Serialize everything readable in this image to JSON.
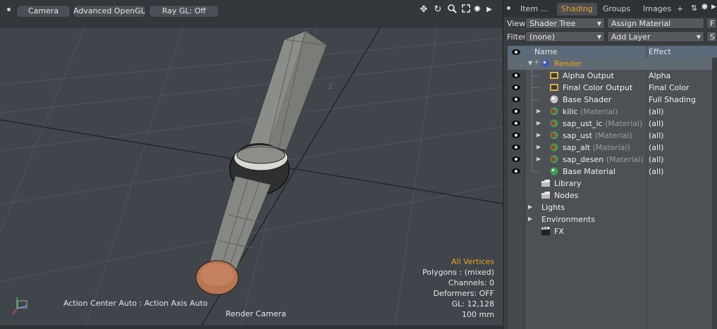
{
  "viewport": {
    "buttons": {
      "camera": "Camera",
      "opengl": "Advanced OpenGL",
      "raygl": "Ray GL: Off"
    },
    "icons": [
      "move-icon",
      "rotate-icon",
      "zoom-icon",
      "maximize-icon",
      "gear-icon",
      "play-arrow-icon"
    ],
    "axis_label": "Z",
    "hud": {
      "mode": "All Vertices",
      "polygons": "Polygons : (mixed)",
      "channels": "Channels: 0",
      "deformers": "Deformers: OFF",
      "gl": "GL: 12,128",
      "scale": "100 mm",
      "action_center": "Action Center Auto : Action Axis Auto",
      "camera_label": "Render Camera"
    },
    "colors": {
      "hud_highlight": "#f0a020",
      "background": "#3f454b"
    }
  },
  "panel": {
    "tabs": [
      {
        "label": "Item ..."
      },
      {
        "label": "Shading"
      },
      {
        "label": "Groups"
      },
      {
        "label": "Images"
      }
    ],
    "add_tab": "+",
    "view_label": "View",
    "view_value": "Shader Tree",
    "assign_material": "Assign Material",
    "f_button": "F",
    "filter_label": "Filter",
    "filter_value": "(none)",
    "add_layer": "Add Layer",
    "s_button": "S",
    "columns": {
      "name": "Name",
      "effect": "Effect"
    },
    "tree": [
      {
        "name": "Render",
        "effect": ""
      },
      {
        "name": "Alpha Output",
        "effect": "Alpha"
      },
      {
        "name": "Final Color Output",
        "effect": "Final Color"
      },
      {
        "name": "Base Shader",
        "effect": "Full Shading"
      },
      {
        "name": "kilic",
        "sub": "(Material)",
        "effect": "(all)"
      },
      {
        "name": "sap_ust_ic",
        "sub": "(Material)",
        "effect": "(all)"
      },
      {
        "name": "sap_ust",
        "sub": "(Material)",
        "effect": "(all)"
      },
      {
        "name": "sap_alt",
        "sub": "(Material)",
        "effect": "(all)"
      },
      {
        "name": "sap_desen",
        "sub": "(Material)",
        "effect": "(all)"
      },
      {
        "name": "Base Material",
        "effect": "(all)"
      },
      {
        "name": "Library",
        "effect": ""
      },
      {
        "name": "Nodes",
        "effect": ""
      },
      {
        "name": "Lights",
        "effect": ""
      },
      {
        "name": "Environments",
        "effect": ""
      },
      {
        "name": "FX",
        "effect": ""
      }
    ],
    "colors": {
      "active_tab": "#f0a020",
      "render_label": "#f0a020"
    }
  }
}
